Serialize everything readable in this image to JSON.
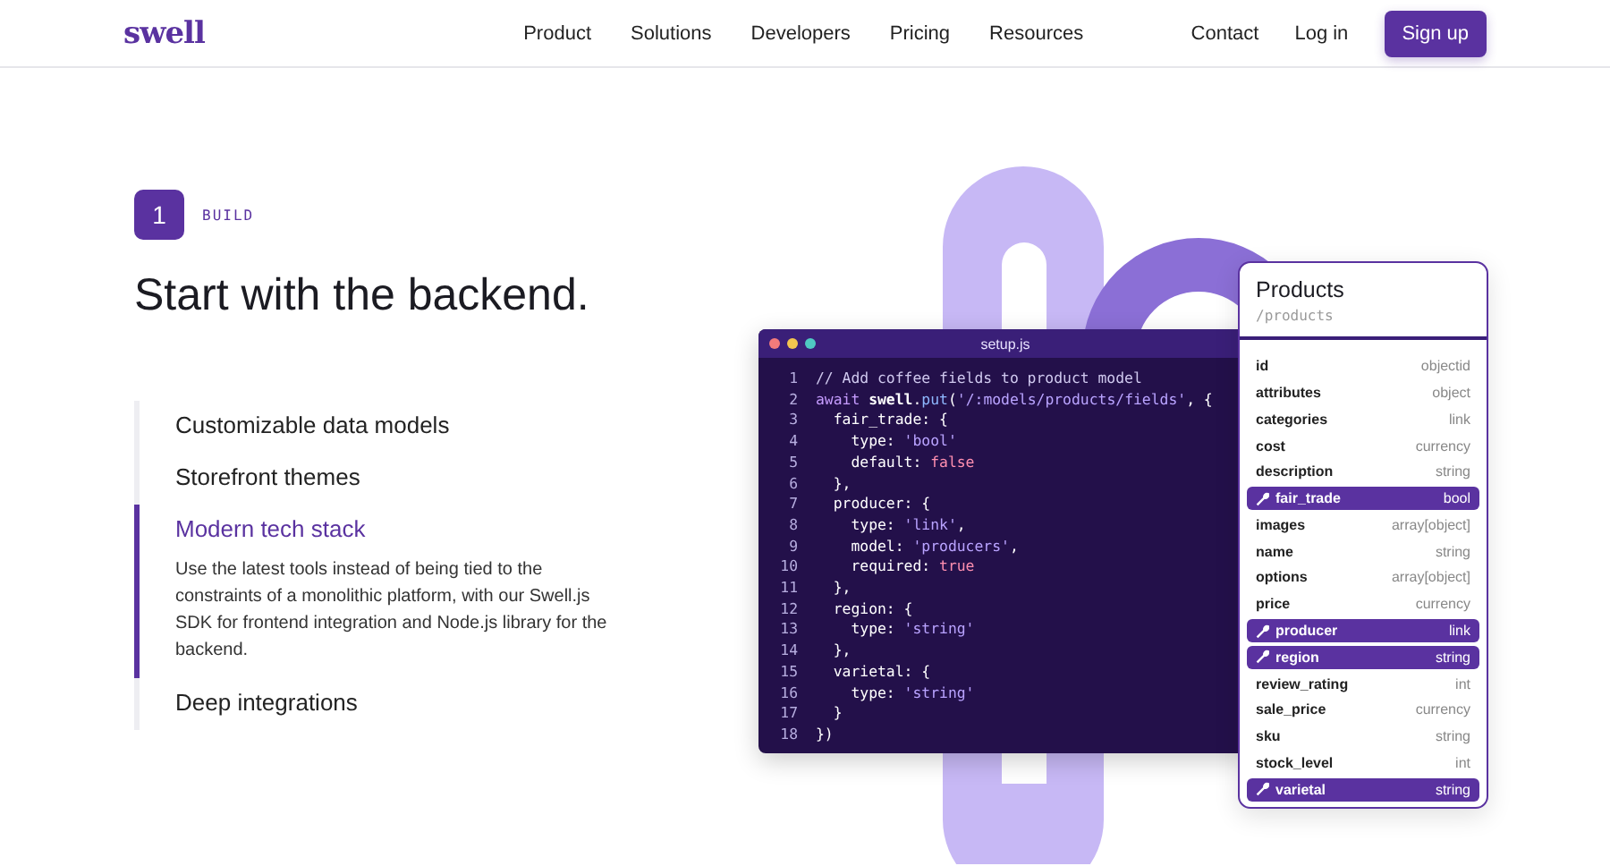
{
  "header": {
    "logo": "swell",
    "nav": [
      "Product",
      "Solutions",
      "Developers",
      "Pricing",
      "Resources"
    ],
    "links": [
      "Contact",
      "Log in"
    ],
    "cta": "Sign up"
  },
  "step": {
    "number": "1",
    "label": "BUILD"
  },
  "heading": "Start with the backend.",
  "features": [
    {
      "title": "Customizable data models",
      "selected": false
    },
    {
      "title": "Storefront themes",
      "selected": false
    },
    {
      "title": "Modern tech stack",
      "selected": true,
      "description": "Use the latest tools instead of being tied to the constraints of a monolithic platform, with our Swell.js SDK for frontend integration and Node.js library for the backend."
    },
    {
      "title": "Deep integrations",
      "selected": false
    }
  ],
  "editor": {
    "filename": "setup.js",
    "lines": [
      {
        "number": "1",
        "tokens": [
          {
            "kind": "comment",
            "text": "// Add coffee fields to product model"
          }
        ]
      },
      {
        "number": "2",
        "tokens": [
          {
            "kind": "keyword",
            "text": "await "
          },
          {
            "kind": "object",
            "text": "swell"
          },
          {
            "kind": "plain",
            "text": "."
          },
          {
            "kind": "method",
            "text": "put"
          },
          {
            "kind": "plain",
            "text": "("
          },
          {
            "kind": "string",
            "text": "'/:models/products/fields'"
          },
          {
            "kind": "plain",
            "text": ", {"
          }
        ]
      },
      {
        "number": "3",
        "tokens": [
          {
            "kind": "key",
            "text": "  fair_trade: {"
          }
        ]
      },
      {
        "number": "4",
        "tokens": [
          {
            "kind": "key",
            "text": "    type: "
          },
          {
            "kind": "string",
            "text": "'bool'"
          }
        ]
      },
      {
        "number": "5",
        "tokens": [
          {
            "kind": "key",
            "text": "    default: "
          },
          {
            "kind": "literal",
            "text": "false"
          }
        ]
      },
      {
        "number": "6",
        "tokens": [
          {
            "kind": "plain",
            "text": "  },"
          }
        ]
      },
      {
        "number": "7",
        "tokens": [
          {
            "kind": "key",
            "text": "  producer: {"
          }
        ]
      },
      {
        "number": "8",
        "tokens": [
          {
            "kind": "key",
            "text": "    type: "
          },
          {
            "kind": "string",
            "text": "'link'"
          },
          {
            "kind": "plain",
            "text": ","
          }
        ]
      },
      {
        "number": "9",
        "tokens": [
          {
            "kind": "key",
            "text": "    model: "
          },
          {
            "kind": "string",
            "text": "'producers'"
          },
          {
            "kind": "plain",
            "text": ","
          }
        ]
      },
      {
        "number": "10",
        "tokens": [
          {
            "kind": "key",
            "text": "    required: "
          },
          {
            "kind": "literal",
            "text": "true"
          }
        ]
      },
      {
        "number": "11",
        "tokens": [
          {
            "kind": "plain",
            "text": "  },"
          }
        ]
      },
      {
        "number": "12",
        "tokens": [
          {
            "kind": "key",
            "text": "  region: {"
          }
        ]
      },
      {
        "number": "13",
        "tokens": [
          {
            "kind": "key",
            "text": "    type: "
          },
          {
            "kind": "string",
            "text": "'string'"
          }
        ]
      },
      {
        "number": "14",
        "tokens": [
          {
            "kind": "plain",
            "text": "  },"
          }
        ]
      },
      {
        "number": "15",
        "tokens": [
          {
            "kind": "key",
            "text": "  varietal: {"
          }
        ]
      },
      {
        "number": "16",
        "tokens": [
          {
            "kind": "key",
            "text": "    type: "
          },
          {
            "kind": "string",
            "text": "'string'"
          }
        ]
      },
      {
        "number": "17",
        "tokens": [
          {
            "kind": "plain",
            "text": "  }"
          }
        ]
      },
      {
        "number": "18",
        "tokens": [
          {
            "kind": "plain",
            "text": "})"
          }
        ]
      }
    ]
  },
  "model": {
    "title": "Products",
    "path": "/products",
    "fields": [
      {
        "name": "id",
        "type": "objectid",
        "custom": false
      },
      {
        "name": "attributes",
        "type": "object",
        "custom": false
      },
      {
        "name": "categories",
        "type": "link",
        "custom": false
      },
      {
        "name": "cost",
        "type": "currency",
        "custom": false
      },
      {
        "name": "description",
        "type": "string",
        "custom": false
      },
      {
        "name": "fair_trade",
        "type": "bool",
        "custom": true
      },
      {
        "name": "images",
        "type": "array[object]",
        "custom": false
      },
      {
        "name": "name",
        "type": "string",
        "custom": false
      },
      {
        "name": "options",
        "type": "array[object]",
        "custom": false
      },
      {
        "name": "price",
        "type": "currency",
        "custom": false
      },
      {
        "name": "producer",
        "type": "link",
        "custom": true
      },
      {
        "name": "region",
        "type": "string",
        "custom": true
      },
      {
        "name": "review_rating",
        "type": "int",
        "custom": false
      },
      {
        "name": "sale_price",
        "type": "currency",
        "custom": false
      },
      {
        "name": "sku",
        "type": "string",
        "custom": false
      },
      {
        "name": "stock_level",
        "type": "int",
        "custom": false
      },
      {
        "name": "varietal",
        "type": "string",
        "custom": true
      }
    ]
  }
}
